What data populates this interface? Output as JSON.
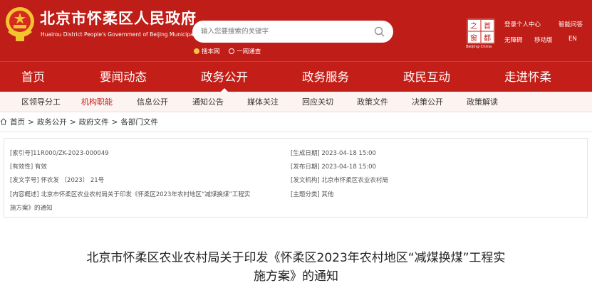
{
  "header": {
    "title": "北京市怀柔区人民政府",
    "subtitle": "Huairou District People's Government of Beijing Municipality",
    "search_placeholder": "输入您要搜索的关键字",
    "search_scopes": [
      "搜本网",
      "一网通查"
    ],
    "logo_chars": [
      "之",
      "首",
      "窗",
      "都"
    ],
    "logo_label": "Beijing·China",
    "links": {
      "login": "登录个人中心",
      "assist": "无障碍",
      "mobile": "移动版",
      "robot": "智能问答",
      "lang": "EN"
    }
  },
  "nav": {
    "items": [
      "首页",
      "要闻动态",
      "政务公开",
      "政务服务",
      "政民互动",
      "走进怀柔"
    ],
    "active": "政务公开"
  },
  "subnav": {
    "items": [
      "区领导分工",
      "机构职能",
      "信息公开",
      "通知公告",
      "媒体关注",
      "回应关切",
      "政策文件",
      "决策公开",
      "政策解读"
    ],
    "active": "机构职能"
  },
  "breadcrumb": [
    "首页",
    "政务公开",
    "政府文件",
    "各部门文件"
  ],
  "meta": {
    "index_no": "[索引号]11R000/ZK-2023-000049",
    "created": "[生成日期] 2023-04-18 15:00",
    "validity": "[有效性] 有效",
    "published": "[发布日期] 2023-04-18 15:00",
    "doc_no": "[发文字号] 怀农发 〔2023〕 21号",
    "issuer": "[发文机构] 北京市怀柔区农业农村局",
    "summary_line1": "[内容概述] 北京市怀柔区农业农村局关于印发《怀柔区2023年农村地区“减煤换煤”工程实",
    "summary_line2": "施方案》的通知",
    "topic": "[主题分类] 其他"
  },
  "document": {
    "title_line1": "北京市怀柔区农业农村局关于印发《怀柔区2023年农村地区“减煤换煤”工程实",
    "title_line2": "施方案》的通知"
  },
  "colors": {
    "brand_red": "#bf1d17",
    "subnav_bg": "#fdf3f0",
    "active_sub": "#c41e18"
  }
}
